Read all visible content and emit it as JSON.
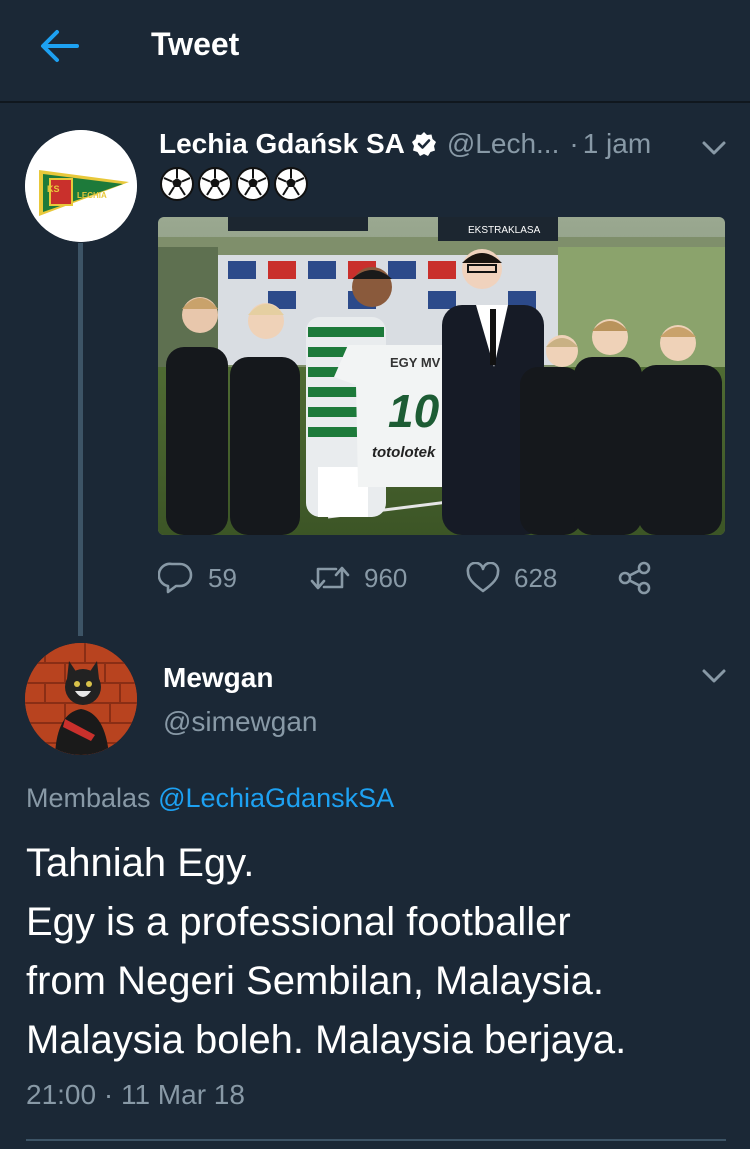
{
  "header": {
    "title": "Tweet"
  },
  "original_tweet": {
    "author_name": "Lechia Gdańsk SA",
    "author_handle": "@Lech...",
    "separator": "·",
    "time": "1 jam",
    "emojis": [
      "soccer-ball",
      "soccer-ball",
      "soccer-ball",
      "soccer-ball"
    ],
    "media_alt": "Player holding EGY MV 10 jersey with official and youth players in stadium",
    "jersey_name": "EGY MV",
    "jersey_number": "10",
    "jersey_sponsor": "totolotek",
    "banner_text": "EKSTRAKLASA",
    "avatar_text_left": "KS",
    "avatar_text_right": "LECHIA",
    "stats": {
      "replies": "59",
      "retweets": "960",
      "likes": "628"
    }
  },
  "reply_tweet": {
    "author_name": "Mewgan",
    "author_handle": "@simewgan",
    "replying_label": "Membalas",
    "replying_to": "@LechiaGdanskSA",
    "text_lines": [
      "Tahniah Egy.",
      "Egy is a professional footballer",
      "from Negeri Sembilan, Malaysia.",
      "Malaysia boleh. Malaysia berjaya."
    ],
    "timestamp": "21:00 · 11 Mar 18"
  },
  "colors": {
    "background": "#1b2836",
    "accent": "#1da1f2",
    "secondary_text": "#8899a6",
    "divider": "#3d5466"
  }
}
